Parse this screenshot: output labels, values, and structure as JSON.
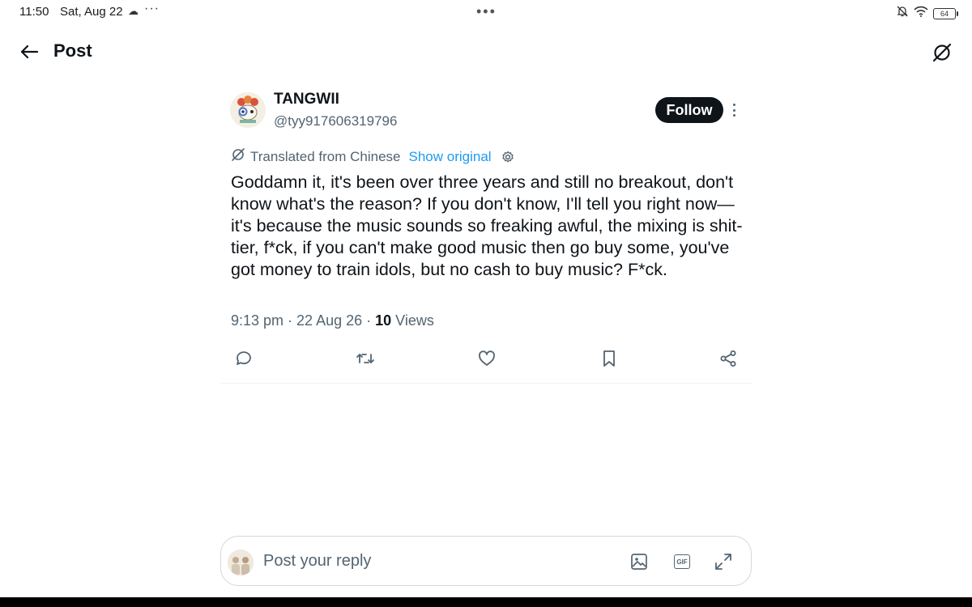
{
  "status_bar": {
    "time": "11:50",
    "date": "Sat, Aug 22",
    "battery": "64"
  },
  "header": {
    "title": "Post"
  },
  "post": {
    "author_name": "TANGWII",
    "author_handle": "@tyy917606319796",
    "follow_label": "Follow",
    "translated_label": "Translated from Chinese",
    "show_original_label": "Show original",
    "text": "Goddamn it, it's been over three years and still no breakout, don't know what's the reason? If you don't know, I'll tell you right now—it's because the music sounds so freaking awful, the mixing is shit-tier, f*ck, if you can't make good music then go buy some, you've got money to train idols, but no cash to buy music? F*ck.",
    "time": "9:13 pm",
    "date": "22 Aug 26",
    "views_count": "10",
    "views_label": "Views",
    "separator": "·"
  },
  "reply": {
    "placeholder": "Post your reply",
    "gif_label": "GIF"
  },
  "colors": {
    "accent": "#1d9bf0",
    "text_primary": "#0f1419",
    "text_secondary": "#536471",
    "border": "#cfd9de"
  }
}
